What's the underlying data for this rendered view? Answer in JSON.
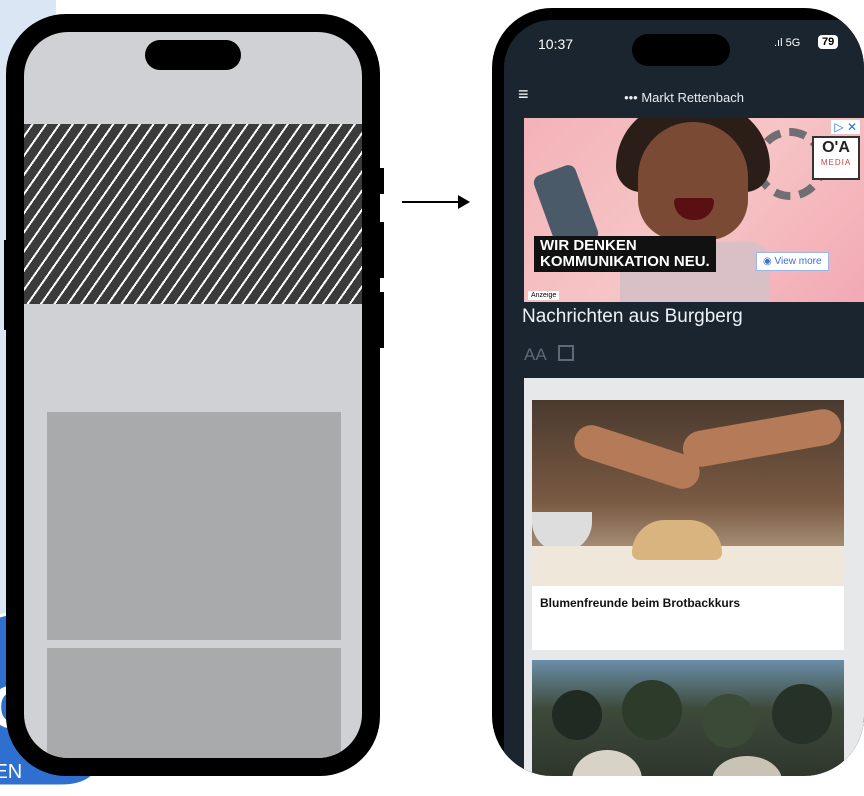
{
  "left_mockup": {},
  "right_phone": {
    "status": {
      "time": "10:37",
      "signal": "5G",
      "battery": "79"
    },
    "nav": {
      "title": "••• Markt Rettenbach"
    },
    "ad": {
      "slogan_line1": "WIR DENKEN",
      "slogan_line2": "KOMMUNIKATION NEU.",
      "view_more": "View more",
      "label": "Anzeige",
      "logo_top": "O'A",
      "logo_bottom": "MEDIA",
      "adchoices": "▷ ✕"
    },
    "headline": "Nachrichten aus Burgberg",
    "tools": {
      "font_size": "AA"
    },
    "articles": [
      {
        "title": "Blumenfreunde beim Brotbackkurs"
      },
      {
        "title": ""
      }
    ]
  },
  "colors": {
    "app_bg": "#1b2530",
    "placeholder_gray": "#a9aaac",
    "frame": "#000000"
  }
}
